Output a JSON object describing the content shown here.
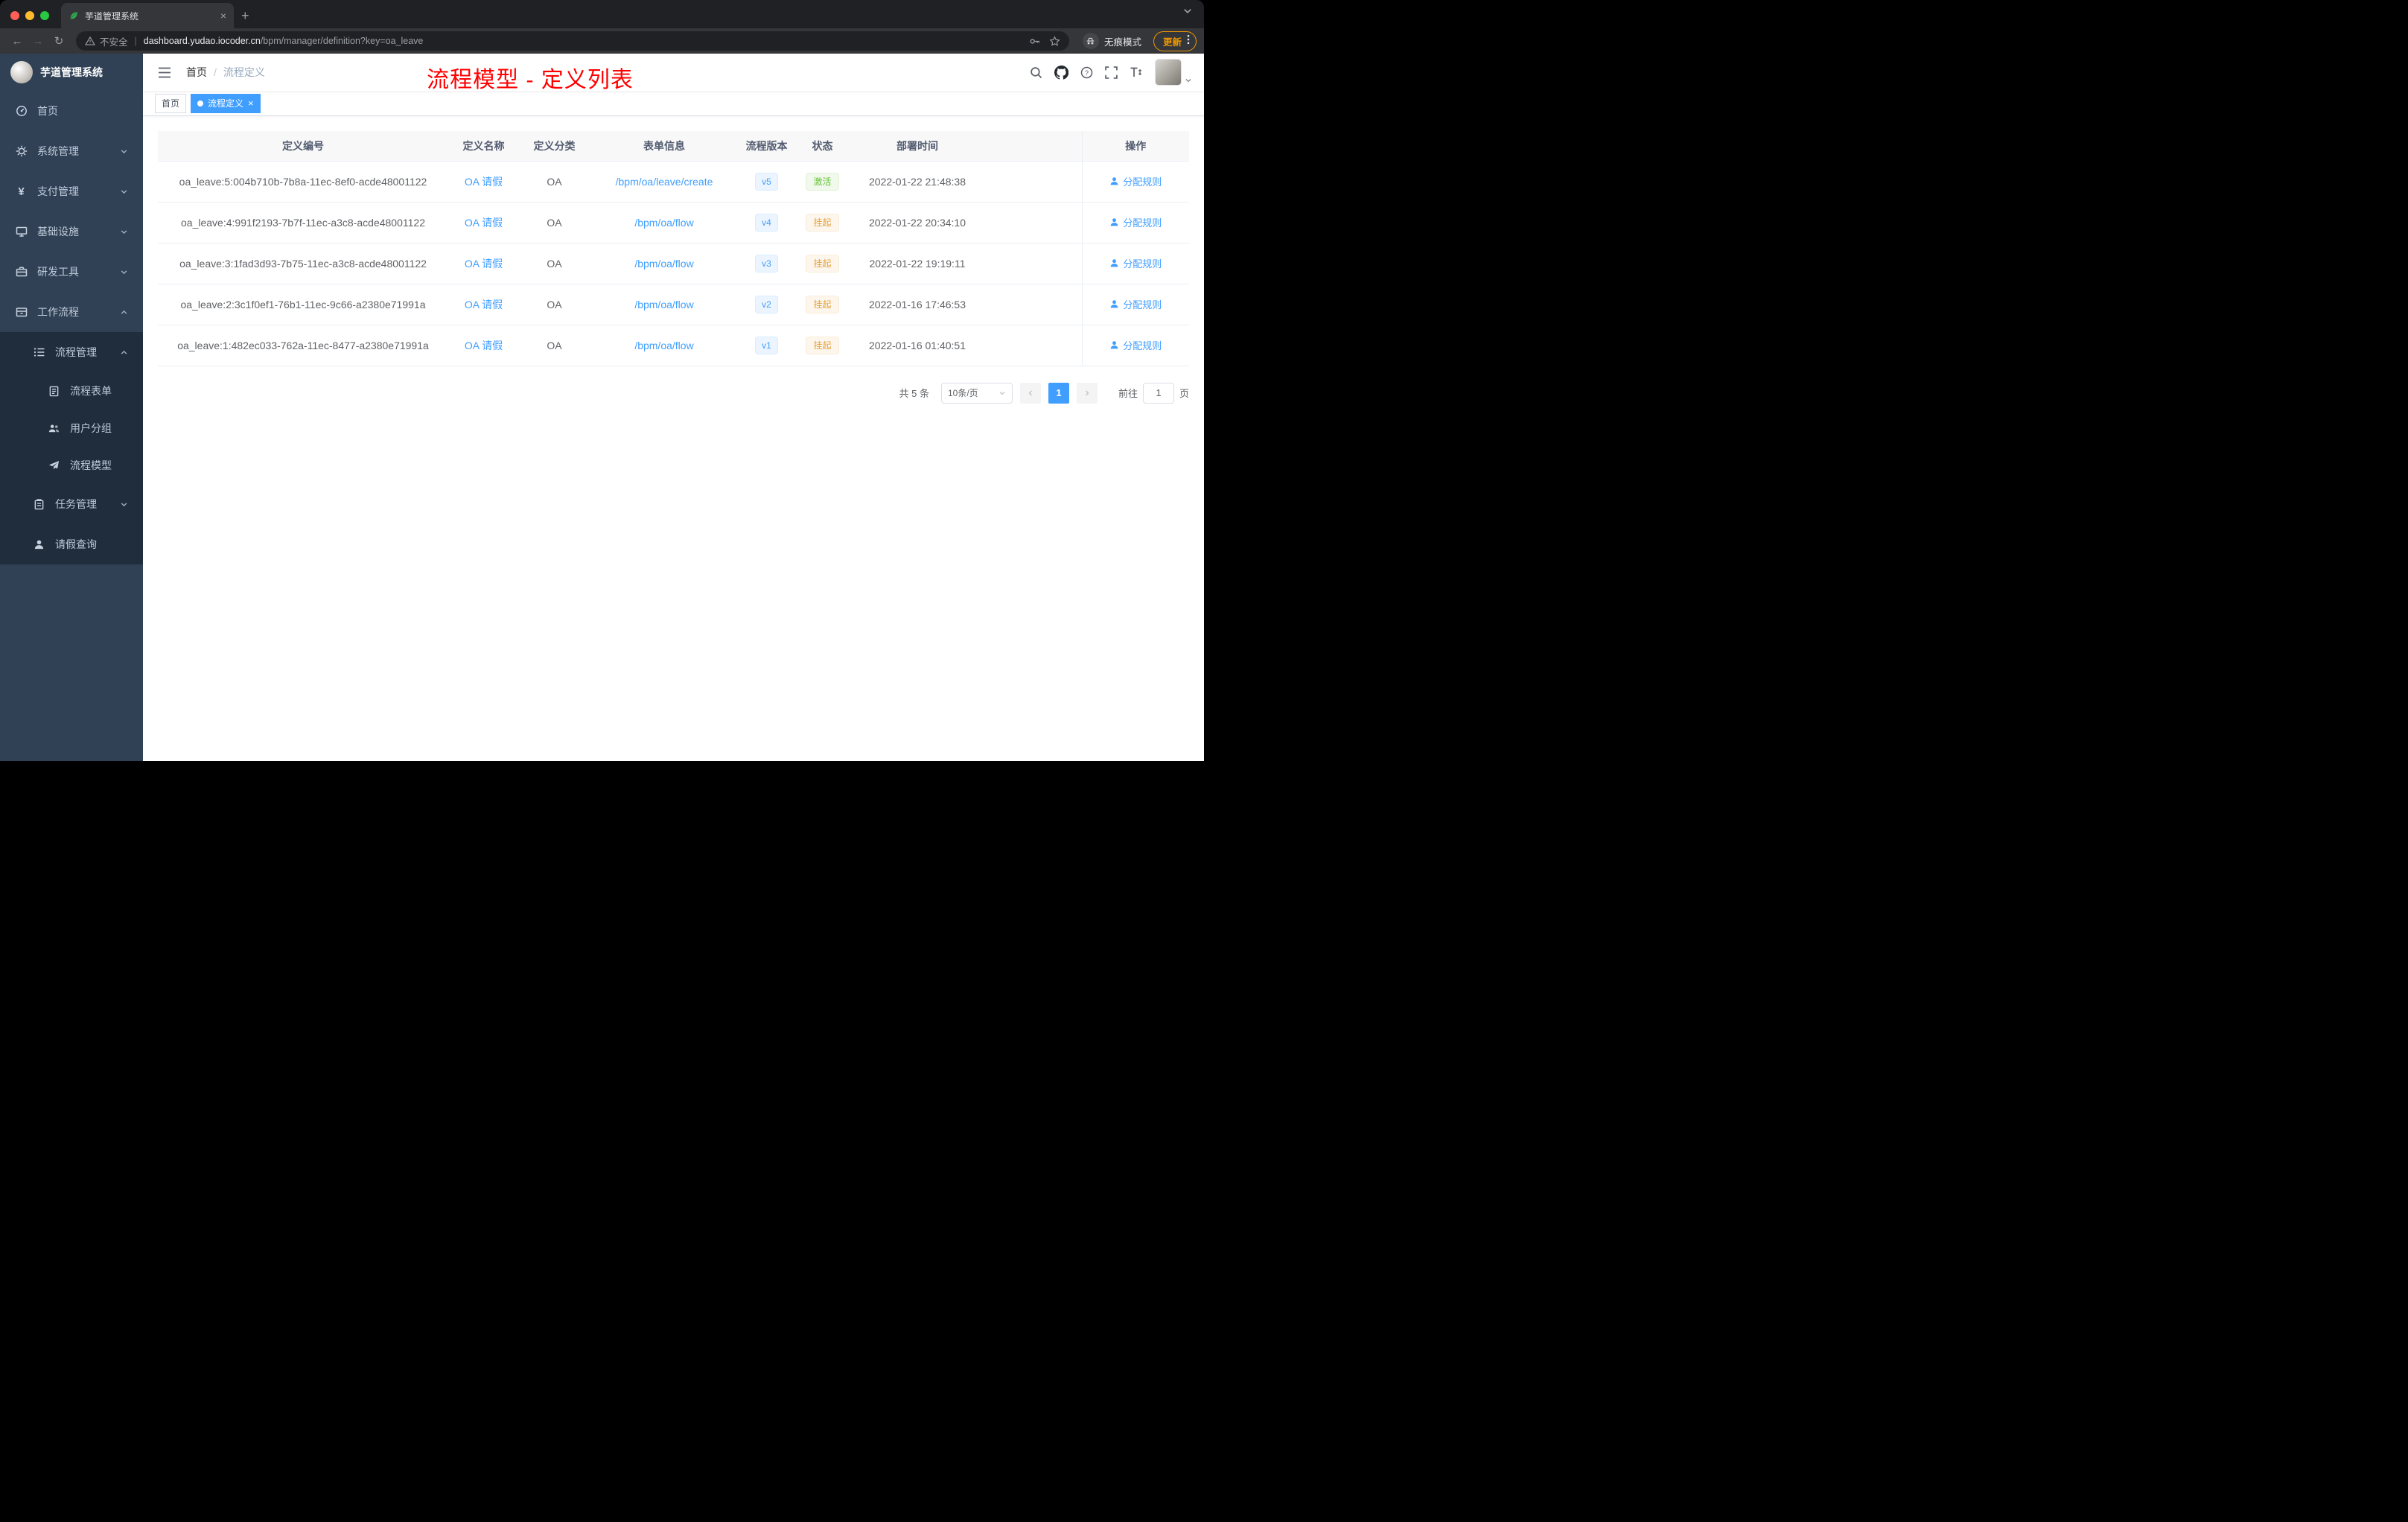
{
  "browser": {
    "tab_title": "芋道管理系统",
    "security_label": "不安全",
    "url_host": "dashboard.yudao.iocoder.cn",
    "url_path": "/bpm/manager/definition?key=oa_leave",
    "incognito_label": "无痕模式",
    "update_label": "更新"
  },
  "sidebar": {
    "brand": "芋道管理系统",
    "menu": {
      "home": "首页",
      "system": "系统管理",
      "payment": "支付管理",
      "infra": "基础设施",
      "devtools": "研发工具",
      "workflow": "工作流程",
      "process_mgmt": "流程管理",
      "process_form": "流程表单",
      "user_group": "用户分组",
      "process_model": "流程模型",
      "task_mgmt": "任务管理",
      "leave_query": "请假查询"
    }
  },
  "header": {
    "breadcrumb_home": "首页",
    "breadcrumb_sep": "/",
    "breadcrumb_current": "流程定义",
    "page_title": "流程模型 - 定义列表"
  },
  "tags": {
    "home": "首页",
    "current": "流程定义"
  },
  "table": {
    "columns": {
      "id": "定义编号",
      "name": "定义名称",
      "category": "定义分类",
      "form": "表单信息",
      "version": "流程版本",
      "status": "状态",
      "time": "部署时间",
      "action": "操作"
    },
    "rows": [
      {
        "id": "oa_leave:5:004b710b-7b8a-11ec-8ef0-acde48001122",
        "name": "OA 请假",
        "category": "OA",
        "form": "/bpm/oa/leave/create",
        "version": "v5",
        "status": "激活",
        "status_type": "success",
        "time": "2022-01-22 21:48:38",
        "action": "分配规则"
      },
      {
        "id": "oa_leave:4:991f2193-7b7f-11ec-a3c8-acde48001122",
        "name": "OA 请假",
        "category": "OA",
        "form": "/bpm/oa/flow",
        "version": "v4",
        "status": "挂起",
        "status_type": "warning",
        "time": "2022-01-22 20:34:10",
        "action": "分配规则"
      },
      {
        "id": "oa_leave:3:1fad3d93-7b75-11ec-a3c8-acde48001122",
        "name": "OA 请假",
        "category": "OA",
        "form": "/bpm/oa/flow",
        "version": "v3",
        "status": "挂起",
        "status_type": "warning",
        "time": "2022-01-22 19:19:11",
        "action": "分配规则"
      },
      {
        "id": "oa_leave:2:3c1f0ef1-76b1-11ec-9c66-a2380e71991a",
        "name": "OA 请假",
        "category": "OA",
        "form": "/bpm/oa/flow",
        "version": "v2",
        "status": "挂起",
        "status_type": "warning",
        "time": "2022-01-16 17:46:53",
        "action": "分配规则"
      },
      {
        "id": "oa_leave:1:482ec033-762a-11ec-8477-a2380e71991a",
        "name": "OA 请假",
        "category": "OA",
        "form": "/bpm/oa/flow",
        "version": "v1",
        "status": "挂起",
        "status_type": "warning",
        "time": "2022-01-16 01:40:51",
        "action": "分配规则"
      }
    ]
  },
  "pagination": {
    "total": "共 5 条",
    "page_size": "10条/页",
    "current_page": "1",
    "goto_label": "前往",
    "goto_value": "1",
    "page_unit": "页"
  },
  "colors": {
    "accent": "#409eff",
    "success": "#67c23a",
    "warning": "#e6a23c",
    "title_red": "#ff0000",
    "sidebar_bg": "#304156",
    "submenu_bg": "#1f2d3d"
  }
}
